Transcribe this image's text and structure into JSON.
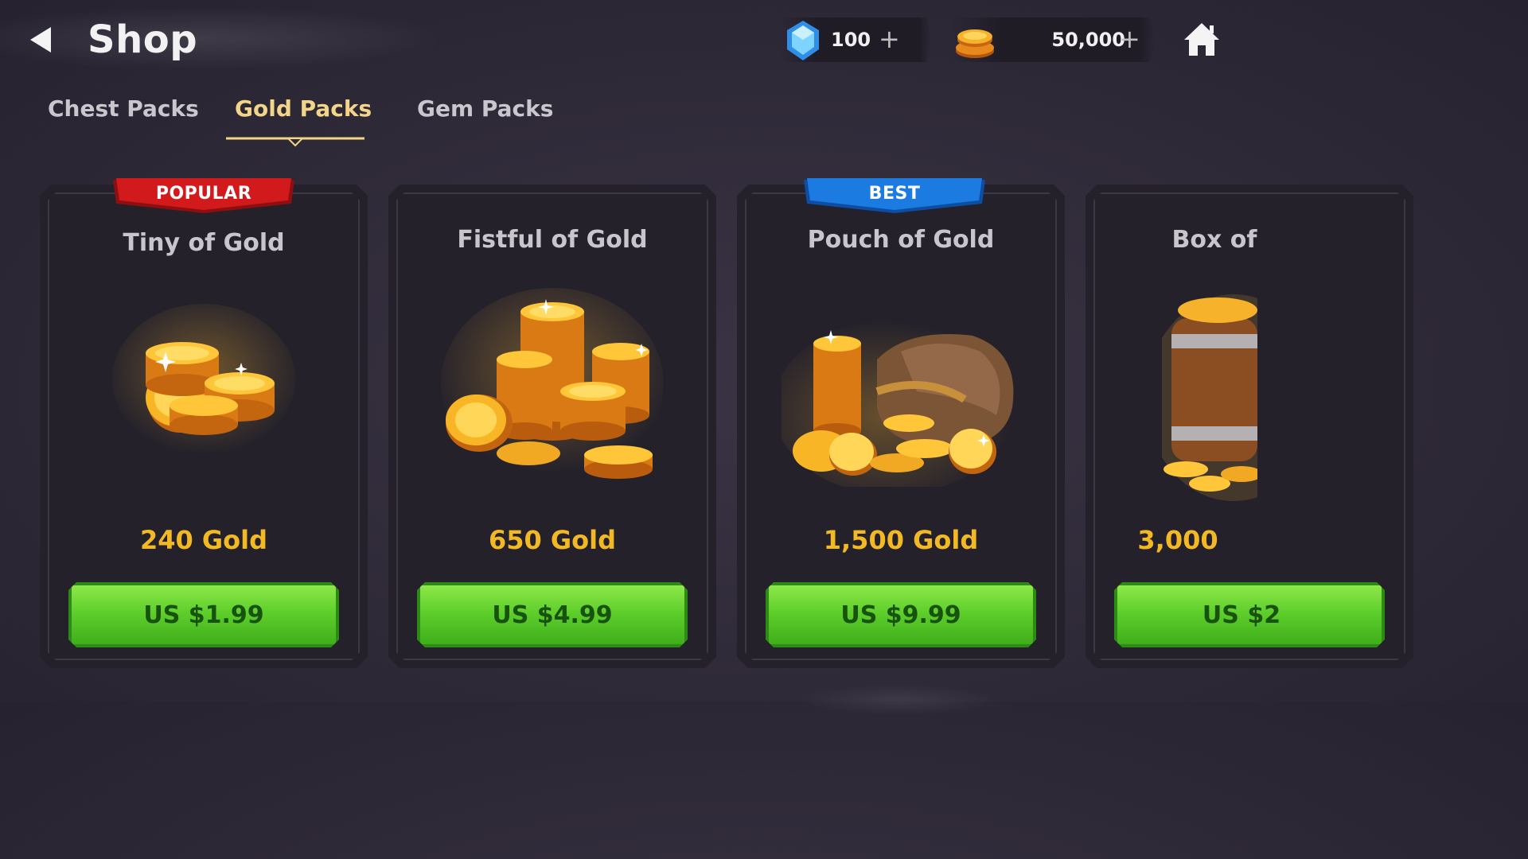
{
  "header": {
    "title": "Shop",
    "gems": "100",
    "gold": "50,000",
    "plus": "+"
  },
  "tabs": [
    {
      "label": "Chest Packs",
      "active": false
    },
    {
      "label": "Gold Packs",
      "active": true
    },
    {
      "label": "Gem Packs",
      "active": false
    }
  ],
  "cards": [
    {
      "name": "Tiny of Gold",
      "amount": "240 Gold",
      "price": "US $1.99",
      "badge": "POPULAR",
      "icon": "small-gold-pile-icon"
    },
    {
      "name": "Fistful of Gold",
      "amount": "650 Gold",
      "price": "US $4.99",
      "badge": "",
      "icon": "gold-stacks-icon"
    },
    {
      "name": "Pouch of Gold",
      "amount": "1,500 Gold",
      "price": "US $9.99",
      "badge": "BEST",
      "icon": "gold-pouch-icon"
    },
    {
      "name": "Box of",
      "amount": "3,000",
      "price": "US $2",
      "badge": "",
      "icon": "gold-barrel-icon"
    }
  ],
  "colors": {
    "accent_gold": "#f2b925",
    "tab_active": "#f3d58a",
    "buy_green": "#5fcf2c",
    "popular_red": "#c81e1e",
    "best_blue": "#1b7be0"
  }
}
